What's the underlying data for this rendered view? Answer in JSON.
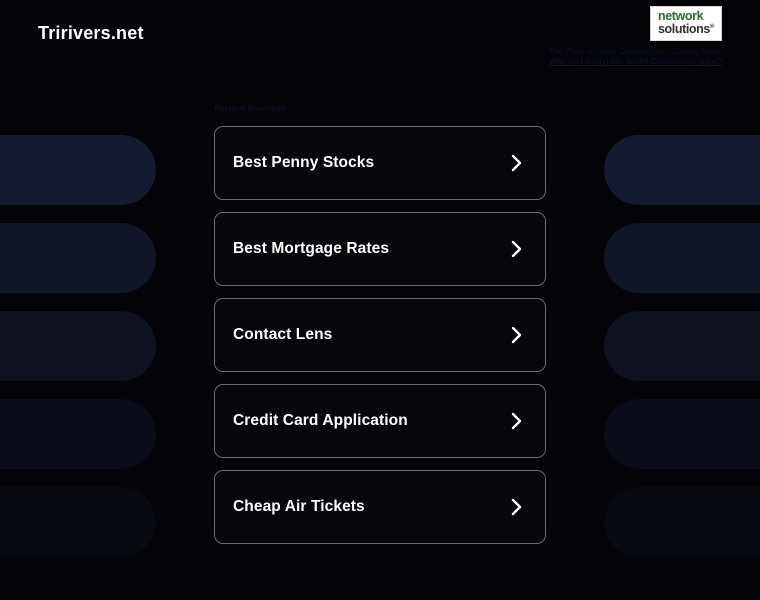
{
  "page": {
    "site_title": "Tririvers.net",
    "background_color": "#030308",
    "accent_ghost_color": "#141a30",
    "card_border_color": "#6b6b72"
  },
  "branding": {
    "logo_name": "network-solutions-logo",
    "logo_line1": "network",
    "logo_line2": "solutions",
    "logo_registered_mark": "®",
    "notice_text": "This Page Is Under Construction - Coming Soon!",
    "notice_link": "Why am I seeing this 'Under Construction' page?"
  },
  "related": {
    "heading": "Related Searches",
    "chevron_icon": "chevron-right-icon",
    "items": [
      {
        "label": "Best Penny Stocks"
      },
      {
        "label": "Best Mortgage Rates"
      },
      {
        "label": "Contact Lens"
      },
      {
        "label": "Credit Card Application"
      },
      {
        "label": "Cheap Air Tickets"
      }
    ]
  }
}
